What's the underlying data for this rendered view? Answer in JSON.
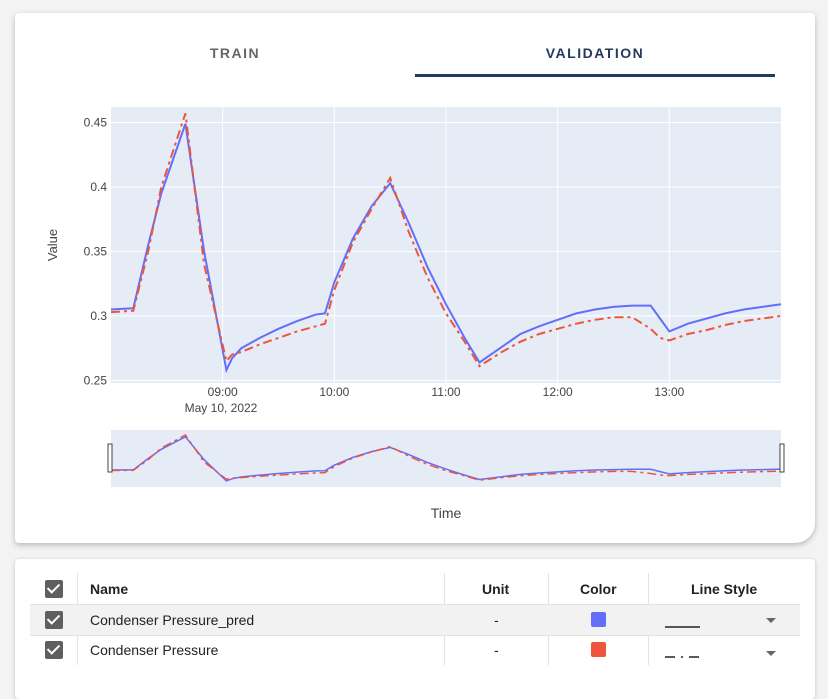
{
  "tabs": [
    {
      "label": "TRAIN",
      "active": false
    },
    {
      "label": "VALIDATION",
      "active": true
    }
  ],
  "chart_data": {
    "type": "line",
    "title": "",
    "xlabel": "Time",
    "ylabel": "Value",
    "x_ticks": [
      "09:00",
      "10:00",
      "11:00",
      "12:00",
      "13:00"
    ],
    "x_date_label": "May 10, 2022",
    "y_ticks": [
      "0.25",
      "0.3",
      "0.35",
      "0.4",
      "0.45"
    ],
    "xlim": [
      "08:00",
      "14:00"
    ],
    "ylim": [
      0.248,
      0.462
    ],
    "grid": true,
    "rangeslider": true,
    "series": [
      {
        "name": "Condenser Pressure_pred",
        "color": "#636efa",
        "dash": "solid",
        "x": [
          "08:00",
          "08:12",
          "08:20",
          "08:27",
          "08:40",
          "08:50",
          "09:02",
          "09:05",
          "09:10",
          "09:20",
          "09:30",
          "09:40",
          "09:50",
          "09:55",
          "10:00",
          "10:10",
          "10:20",
          "10:30",
          "10:40",
          "10:50",
          "11:00",
          "11:10",
          "11:18",
          "11:30",
          "11:40",
          "11:50",
          "12:00",
          "12:10",
          "12:20",
          "12:30",
          "12:40",
          "12:50",
          "12:55",
          "13:00",
          "13:10",
          "13:20",
          "13:30",
          "13:40",
          "13:50",
          "14:00"
        ],
        "y": [
          0.305,
          0.306,
          0.355,
          0.395,
          0.449,
          0.35,
          0.258,
          0.267,
          0.275,
          0.283,
          0.29,
          0.296,
          0.301,
          0.302,
          0.326,
          0.36,
          0.385,
          0.403,
          0.372,
          0.338,
          0.309,
          0.283,
          0.264,
          0.276,
          0.286,
          0.292,
          0.297,
          0.302,
          0.305,
          0.307,
          0.308,
          0.308,
          0.298,
          0.288,
          0.294,
          0.298,
          0.302,
          0.305,
          0.307,
          0.309
        ]
      },
      {
        "name": "Condenser Pressure",
        "color": "#ef553b",
        "dash": "dashdot",
        "x": [
          "08:00",
          "08:12",
          "08:20",
          "08:27",
          "08:40",
          "08:50",
          "09:02",
          "09:05",
          "09:10",
          "09:20",
          "09:30",
          "09:40",
          "09:50",
          "09:55",
          "10:00",
          "10:10",
          "10:20",
          "10:30",
          "10:40",
          "10:50",
          "11:00",
          "11:10",
          "11:18",
          "11:30",
          "11:40",
          "11:50",
          "12:00",
          "12:10",
          "12:20",
          "12:30",
          "12:40",
          "12:50",
          "12:55",
          "13:00",
          "13:10",
          "13:20",
          "13:30",
          "13:40",
          "13:50",
          "14:00"
        ],
        "y": [
          0.303,
          0.304,
          0.35,
          0.4,
          0.457,
          0.34,
          0.265,
          0.27,
          0.272,
          0.278,
          0.283,
          0.288,
          0.292,
          0.294,
          0.32,
          0.357,
          0.383,
          0.407,
          0.365,
          0.33,
          0.302,
          0.28,
          0.261,
          0.272,
          0.28,
          0.286,
          0.29,
          0.294,
          0.297,
          0.299,
          0.299,
          0.29,
          0.283,
          0.281,
          0.286,
          0.289,
          0.293,
          0.296,
          0.298,
          0.3
        ]
      }
    ]
  },
  "table": {
    "headers": {
      "name": "Name",
      "unit": "Unit",
      "color": "Color",
      "line_style": "Line Style"
    },
    "rows": [
      {
        "name": "Condenser Pressure_pred",
        "unit": "-",
        "color": "#636efa",
        "line_style": "solid",
        "checked": true
      },
      {
        "name": "Condenser Pressure",
        "unit": "-",
        "color": "#ef553b",
        "line_style": "dashdot",
        "checked": true
      }
    ]
  }
}
